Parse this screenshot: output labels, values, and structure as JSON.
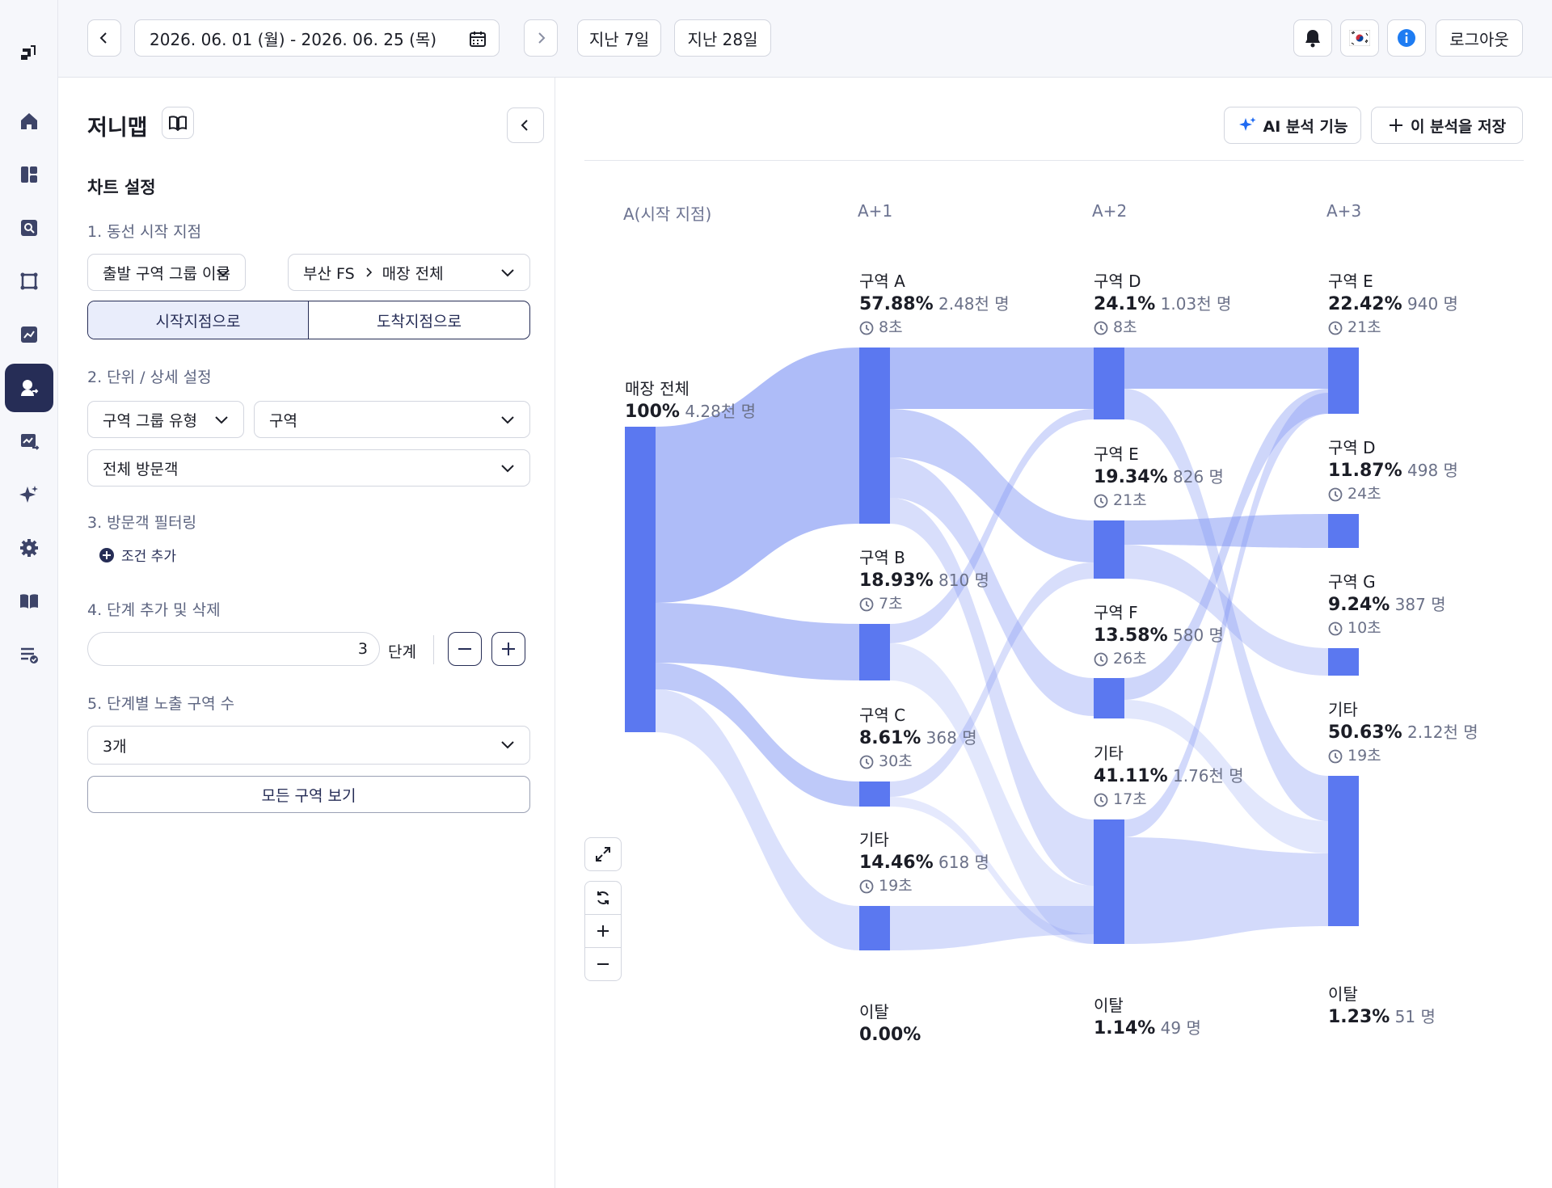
{
  "topbar": {
    "date_range": "2026. 06. 01 (월) - 2026. 06. 25 (목)",
    "last7": "지난 7일",
    "last28": "지난 28일",
    "logout": "로그아웃",
    "flag": "🇰🇷"
  },
  "panel": {
    "title": "저니맵",
    "chart_settings": "차트 설정",
    "s1_label": "1. 동선 시작 지점",
    "s1_dropdown": "출발 구역 그룹 이름",
    "s1_store": "부산 FS",
    "s1_scope": "매장 전체",
    "toggle_start": "시작지점으로",
    "toggle_end": "도착지점으로",
    "s2_label": "2. 단위 / 상세 설정",
    "s2_group_type": "구역 그룹 유형",
    "s2_zone": "구역",
    "s2_visitors": "전체 방문객",
    "s3_label": "3. 방문객 필터링",
    "add_condition": "조건 추가",
    "s4_label": "4. 단계 추가 및 삭제",
    "steps_value": "3",
    "steps_unit": "단계",
    "s5_label": "5. 단계별 노출 구역 수",
    "zone_count": "3개",
    "view_all": "모든 구역 보기"
  },
  "main": {
    "ai_btn": "AI 분석 기능",
    "save_btn": "이 분석을 저장"
  },
  "colors": {
    "node": "#5b78f0",
    "flow": "#8da0f5",
    "accent": "#262d56"
  },
  "chart_data": {
    "type": "sankey",
    "columns": [
      "A(시작 지점)",
      "A+1",
      "A+2",
      "A+3"
    ],
    "nodes": [
      {
        "col": 0,
        "name": "매장 전체",
        "pct": "100%",
        "count": "4.28천 명",
        "time": ""
      },
      {
        "col": 1,
        "name": "구역 A",
        "pct": "57.88%",
        "count": "2.48천 명",
        "time": "8초"
      },
      {
        "col": 1,
        "name": "구역 B",
        "pct": "18.93%",
        "count": "810 명",
        "time": "7초"
      },
      {
        "col": 1,
        "name": "구역 C",
        "pct": "8.61%",
        "count": "368 명",
        "time": "30초"
      },
      {
        "col": 1,
        "name": "기타",
        "pct": "14.46%",
        "count": "618 명",
        "time": "19초"
      },
      {
        "col": 1,
        "name": "이탈",
        "pct": "0.00%",
        "count": "",
        "time": ""
      },
      {
        "col": 2,
        "name": "구역 D",
        "pct": "24.1%",
        "count": "1.03천 명",
        "time": "8초"
      },
      {
        "col": 2,
        "name": "구역 E",
        "pct": "19.34%",
        "count": "826 명",
        "time": "21초"
      },
      {
        "col": 2,
        "name": "구역 F",
        "pct": "13.58%",
        "count": "580 명",
        "time": "26초"
      },
      {
        "col": 2,
        "name": "기타",
        "pct": "41.11%",
        "count": "1.76천 명",
        "time": "17초"
      },
      {
        "col": 2,
        "name": "이탈",
        "pct": "1.14%",
        "count": "49 명",
        "time": ""
      },
      {
        "col": 3,
        "name": "구역 E",
        "pct": "22.42%",
        "count": "940 명",
        "time": "21초"
      },
      {
        "col": 3,
        "name": "구역 D",
        "pct": "11.87%",
        "count": "498 명",
        "time": "24초"
      },
      {
        "col": 3,
        "name": "구역 G",
        "pct": "9.24%",
        "count": "387 명",
        "time": "10초"
      },
      {
        "col": 3,
        "name": "기타",
        "pct": "50.63%",
        "count": "2.12천 명",
        "time": "19초"
      },
      {
        "col": 3,
        "name": "이탈",
        "pct": "1.23%",
        "count": "51 명",
        "time": ""
      }
    ]
  }
}
